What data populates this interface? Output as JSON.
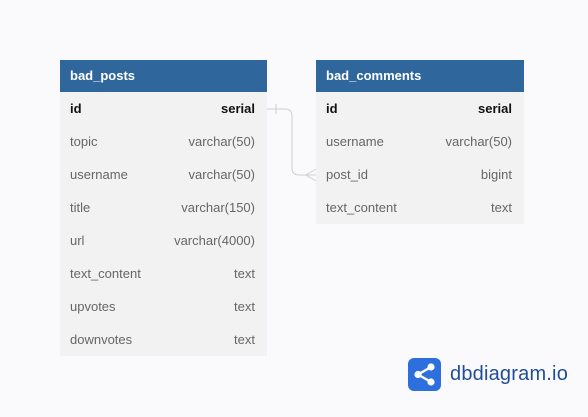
{
  "tables": [
    {
      "name": "bad_posts",
      "columns": [
        {
          "name": "id",
          "type": "serial",
          "pk": true
        },
        {
          "name": "topic",
          "type": "varchar(50)"
        },
        {
          "name": "username",
          "type": "varchar(50)"
        },
        {
          "name": "title",
          "type": "varchar(150)"
        },
        {
          "name": "url",
          "type": "varchar(4000)"
        },
        {
          "name": "text_content",
          "type": "text"
        },
        {
          "name": "upvotes",
          "type": "text"
        },
        {
          "name": "downvotes",
          "type": "text"
        }
      ]
    },
    {
      "name": "bad_comments",
      "columns": [
        {
          "name": "id",
          "type": "serial",
          "pk": true
        },
        {
          "name": "username",
          "type": "varchar(50)"
        },
        {
          "name": "post_id",
          "type": "bigint"
        },
        {
          "name": "text_content",
          "type": "text"
        }
      ]
    }
  ],
  "brand": {
    "name": "dbdiagram.io",
    "logo_icon": "dbdiagram-logo-icon"
  },
  "colors": {
    "header": "#2f679c",
    "body": "#f2f2f2",
    "link": "#cfcfcf",
    "background": "#fafafc"
  }
}
